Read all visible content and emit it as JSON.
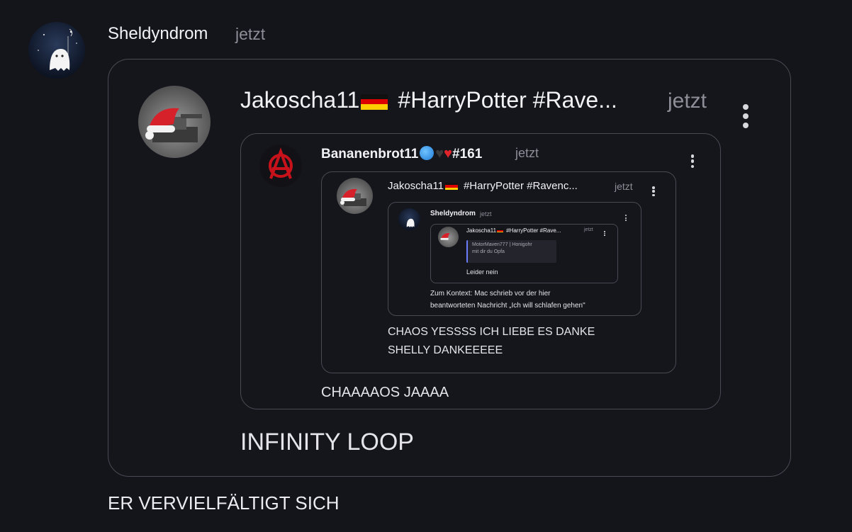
{
  "outer": {
    "author": "Sheldyndrom",
    "time": "jetzt",
    "body": "ER VERVIELFÄLTIGT SICH"
  },
  "level1": {
    "author": "Jakoscha11",
    "tags": "#HarryPotter #Rave...",
    "time": "jetzt",
    "body": "INFINITY LOOP"
  },
  "level2": {
    "author": "Bananenbrot11",
    "suffix": "#161",
    "time": "jetzt",
    "body": "CHAAAAOS JAAAA"
  },
  "level3": {
    "author": "Jakoscha11",
    "tags": "#HarryPotter #Ravenc...",
    "time": "jetzt",
    "body_line1": "CHAOS YESSSS ICH LIEBE ES DANKE",
    "body_line2": "SHELLY DANKEEEEE"
  },
  "level4": {
    "author": "Sheldyndrom",
    "time": "jetzt",
    "body_line1": "Zum Kontext: Mac schrieb vor der hier",
    "body_line2": "beantworteten Nachricht „Ich will schlafen gehen\""
  },
  "level5": {
    "author": "Jakoscha11",
    "tags": "#HarryPotter #Rave...",
    "time": "jetzt",
    "quote_author": "MotorMaven777 | Honigohr",
    "quote_text": "mit dir du Opfa",
    "body": "Leider nein"
  },
  "colors": {
    "background": "#14141b",
    "border": "#4a4a55",
    "quote_bar": "#6b7cff",
    "anarchy_red": "#c8121b"
  }
}
